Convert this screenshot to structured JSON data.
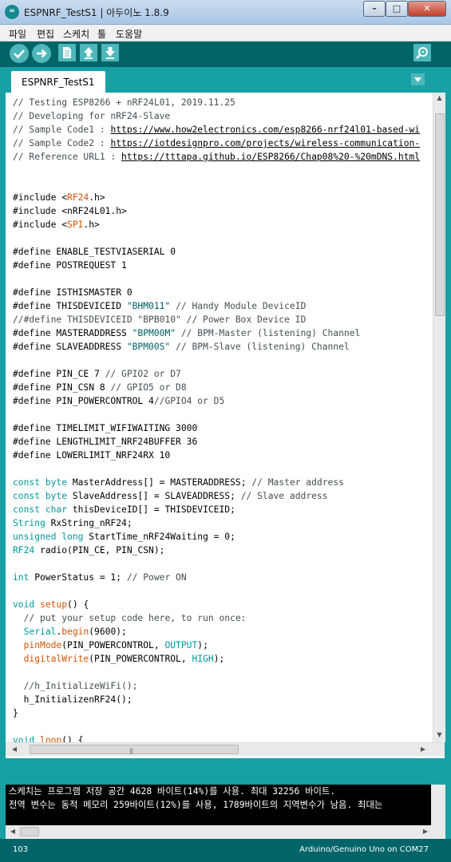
{
  "window": {
    "title": "ESPNRF_TestS1 | 아두이노 1.8.9",
    "app_icon": "arduino-icon",
    "controls": {
      "minimize": "–",
      "maximize": "□",
      "close": "✕"
    }
  },
  "menu": {
    "items": [
      {
        "label": "파일"
      },
      {
        "label": "편집"
      },
      {
        "label": "스케치"
      },
      {
        "label": "툴"
      },
      {
        "label": "도움말"
      }
    ]
  },
  "toolbar": {
    "buttons": [
      {
        "name": "verify",
        "icon": "check-icon"
      },
      {
        "name": "upload",
        "icon": "arrow-right-icon"
      },
      {
        "name": "new",
        "icon": "document-icon"
      },
      {
        "name": "open",
        "icon": "arrow-up-icon"
      },
      {
        "name": "save",
        "icon": "arrow-down-icon"
      }
    ],
    "serial_monitor_icon": "magnifier-icon"
  },
  "tabs": [
    {
      "label": "ESPNRF_TestS1"
    }
  ],
  "editor": {
    "lines": [
      "// Testing ESP8266 + nRF24L01, 2019.11.25",
      "// Developing for nRF24-Slave",
      "// Sample Code1 : https://www.how2electronics.com/esp8266-nrf24l01-based-wi",
      "// Sample Code2 : https://iotdesignpro.com/projects/wireless-communication-",
      "// Reference URL1 : https://tttapa.github.io/ESP8266/Chap08%20-%20mDNS.html",
      "",
      "",
      "#include <RF24.h>",
      "#include <nRF24L01.h>",
      "#include <SPI.h>",
      "",
      "#define ENABLE_TESTVIASERIAL 0",
      "#define POSTREQUEST 1",
      "",
      "#define ISTHISMASTER 0",
      "#define THISDEVICEID \"BHM011\" // Handy Module DeviceID",
      "//#define THISDEVICEID \"BPB010\" // Power Box Device ID",
      "#define MASTERADDRESS \"BPM00M\" // BPM-Master (listening) Channel",
      "#define SLAVEADDRESS \"BPM00S\" // BPM-Slave (listening) Channel",
      "",
      "#define PIN_CE 7 // GPIO2 or D7",
      "#define PIN_CSN 8 // GPIO5 or D8",
      "#define PIN_POWERCONTROL 4//GPIO4 or D5",
      "",
      "#define TIMELIMIT_WIFIWAITING 3000",
      "#define LENGTHLIMIT_NRF24BUFFER 36",
      "#define LOWERLIMIT_NRF24RX 10",
      "",
      "const byte MasterAddress[] = MASTERADDRESS; // Master address",
      "const byte SlaveAddress[] = SLAVEADDRESS; // Slave address",
      "const char thisDeviceID[] = THISDEVICEID;",
      "String RxString_nRF24;",
      "unsigned long StartTime_nRF24Waiting = 0;",
      "RF24 radio(PIN_CE, PIN_CSN);",
      "",
      "int PowerStatus = 1; // Power ON",
      "",
      "void setup() {",
      "  // put your setup code here, to run once:",
      "  Serial.begin(9600);",
      "  pinMode(PIN_POWERCONTROL, OUTPUT);",
      "  digitalWrite(PIN_POWERCONTROL, HIGH);",
      "",
      "  //h_InitializeWiFi();",
      "  h_InitializenRF24();",
      "}",
      "",
      "void loop() {"
    ]
  },
  "console": {
    "lines": [
      "스케치는 프로그램 저장 공간 4628 바이트(14%)를 사용. 최대 32256 바이트.",
      "전역 변수는 동적 메모리 259바이트(12%)를 사용, 1789바이트의 지역변수가 남음.  최대는"
    ]
  },
  "status": {
    "line_number": "103",
    "board": "Arduino/Genuino Uno on COM27"
  },
  "colors": {
    "toolbar_bg": "#006468",
    "tab_strip_bg": "#17a1a5",
    "button_bg": "#4db7bb",
    "comment": "#434f54",
    "keyword": "#00979c",
    "function": "#d35400"
  }
}
